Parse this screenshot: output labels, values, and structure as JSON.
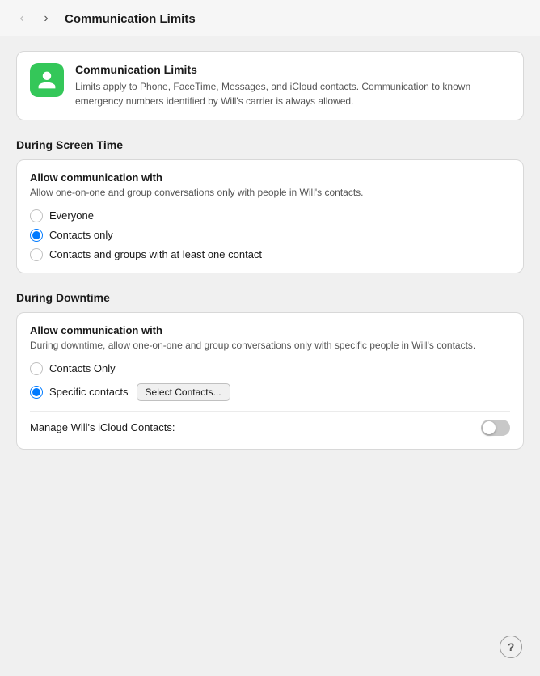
{
  "titleBar": {
    "title": "Communication Limits",
    "backBtn": "‹",
    "forwardBtn": "›"
  },
  "infoCard": {
    "title": "Communication Limits",
    "description": "Limits apply to Phone, FaceTime, Messages, and iCloud contacts. Communication to known emergency numbers identified by Will's carrier is always allowed."
  },
  "screenTime": {
    "sectionTitle": "During Screen Time",
    "cardTitle": "Allow communication with",
    "cardSubtitle": "Allow one-on-one and group conversations only with people in Will's contacts.",
    "options": [
      {
        "label": "Everyone",
        "selected": false
      },
      {
        "label": "Contacts only",
        "selected": true
      },
      {
        "label": "Contacts and groups with at least one contact",
        "selected": false
      }
    ]
  },
  "downtime": {
    "sectionTitle": "During Downtime",
    "cardTitle": "Allow communication with",
    "cardSubtitle": "During downtime, allow one-on-one and group conversations only with specific people in Will's contacts.",
    "options": [
      {
        "label": "Contacts Only",
        "selected": false
      },
      {
        "label": "Specific contacts",
        "selected": true
      }
    ],
    "selectContactsBtn": "Select Contacts...",
    "manageLabel": "Manage Will's iCloud Contacts:",
    "toggleState": false
  },
  "helpBtn": "?"
}
